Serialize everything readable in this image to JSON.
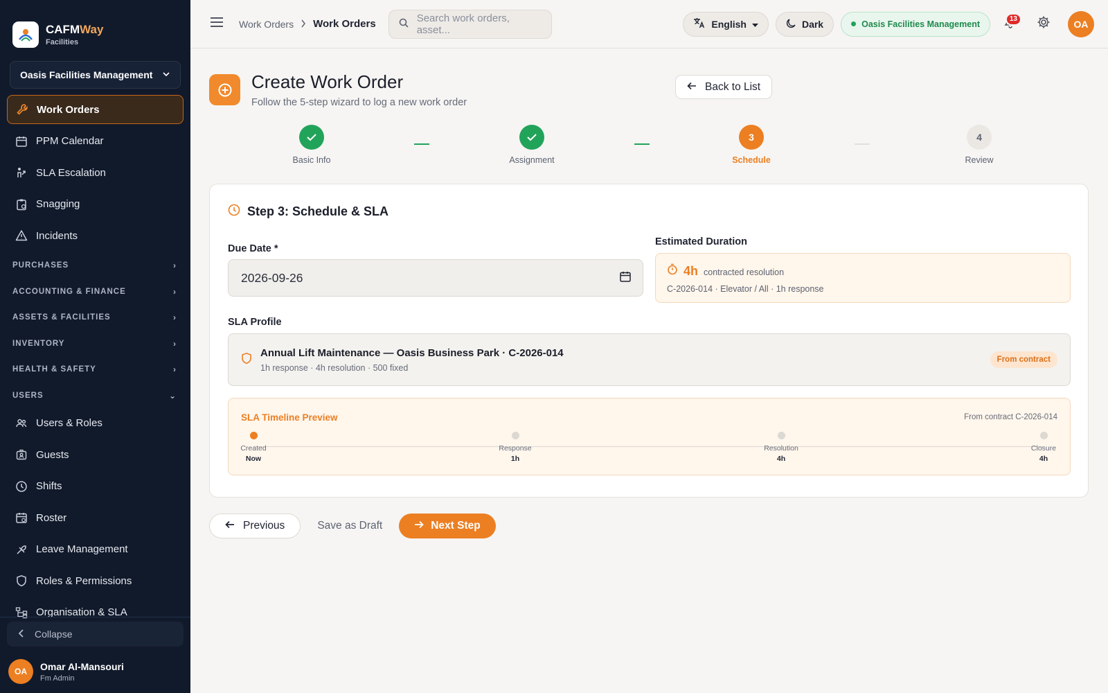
{
  "brand": {
    "name_a": "CAFM",
    "name_b": "Way",
    "sub": "Facilities"
  },
  "org_select": "Oasis Facilities Management",
  "nav_top": [
    {
      "label": "Work Orders",
      "icon": "wrench-icon",
      "active": true
    },
    {
      "label": "PPM Calendar",
      "icon": "calendar-icon"
    },
    {
      "label": "SLA Escalation",
      "icon": "escalation-icon"
    },
    {
      "label": "Snagging",
      "icon": "clipboard-icon"
    },
    {
      "label": "Incidents",
      "icon": "warning-icon"
    }
  ],
  "nav_sections": [
    {
      "label": "PURCHASES",
      "chev": "›"
    },
    {
      "label": "ACCOUNTING & FINANCE",
      "chev": "›"
    },
    {
      "label": "ASSETS & FACILITIES",
      "chev": "›"
    },
    {
      "label": "INVENTORY",
      "chev": "›"
    },
    {
      "label": "HEALTH & SAFETY",
      "chev": "›"
    },
    {
      "label": "USERS",
      "chev": "⌄"
    }
  ],
  "nav_users": [
    {
      "label": "Users & Roles",
      "icon": "users-icon"
    },
    {
      "label": "Guests",
      "icon": "badge-icon"
    },
    {
      "label": "Shifts",
      "icon": "clock-icon"
    },
    {
      "label": "Roster",
      "icon": "calendar-check-icon"
    },
    {
      "label": "Leave Management",
      "icon": "leave-icon"
    },
    {
      "label": "Roles & Permissions",
      "icon": "shield-icon"
    },
    {
      "label": "Organisation & SLA",
      "icon": "org-chart-icon"
    }
  ],
  "collapse_label": "Collapse",
  "user": {
    "initials": "OA",
    "name": "Omar Al-Mansouri",
    "role": "Fm Admin"
  },
  "topbar": {
    "crumb_1": "Work Orders",
    "crumb_2": "Work Orders",
    "search_placeholder": "Search work orders, asset...",
    "language": "English",
    "theme": "Dark",
    "org": "Oasis Facilities Management",
    "notifications": "13",
    "avatar": "OA"
  },
  "page": {
    "title": "Create Work Order",
    "subtitle": "Follow the 5-step wizard to log a new work order",
    "back_label": "Back to List"
  },
  "steps": [
    {
      "label": "Basic Info",
      "state": "done",
      "num": ""
    },
    {
      "label": "Assignment",
      "state": "done",
      "num": ""
    },
    {
      "label": "Schedule",
      "state": "current",
      "num": "3"
    },
    {
      "label": "Review",
      "state": "todo",
      "num": "4"
    }
  ],
  "form": {
    "section_title": "Step 3: Schedule & SLA",
    "due_label": "Due Date *",
    "due_value": "2026-09-26",
    "est_label": "Estimated Duration",
    "est_value": "4h",
    "est_unit": "contracted resolution",
    "est_meta": "C-2026-014 · Elevator / All · 1h response",
    "sla_label": "SLA Profile",
    "sla_name": "Annual Lift Maintenance — Oasis Business Park · C-2026-014",
    "sla_meta": "1h response · 4h resolution · 500 fixed",
    "sla_tag": "From contract"
  },
  "timeline": {
    "title": "SLA Timeline Preview",
    "source": "From contract C-2026-014",
    "points": [
      {
        "name": "Created",
        "value": "Now",
        "active": true
      },
      {
        "name": "Response",
        "value": "1h",
        "active": false
      },
      {
        "name": "Resolution",
        "value": "4h",
        "active": false
      },
      {
        "name": "Closure",
        "value": "4h",
        "active": false
      }
    ]
  },
  "actions": {
    "prev": "Previous",
    "draft": "Save as Draft",
    "next": "Next Step"
  },
  "colors": {
    "accent": "#ec7f22",
    "success": "#22a35a",
    "sidebar": "#111a2b"
  }
}
